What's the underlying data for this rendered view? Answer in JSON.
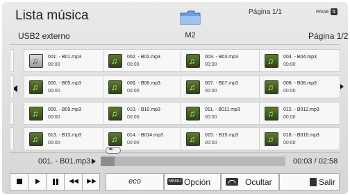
{
  "header": {
    "title": "Lista música",
    "source": "USB2 externo",
    "folder_label": "M2",
    "page_top": "Página 1/1",
    "page_button_label": "PAGE",
    "page_button_key": "⇅",
    "page_right": "Página 1/2"
  },
  "icons": {
    "folder": "folder-icon",
    "music": "music-note-icon",
    "prev_page": "left-arrow-icon",
    "next_page": "right-arrow-icon"
  },
  "tracks": [
    {
      "name": "001. - B01.mp3",
      "time": "00:00",
      "selected": true
    },
    {
      "name": "002. - B02.mp3",
      "time": "00:00"
    },
    {
      "name": "003. - B03.mp3",
      "time": "00:00"
    },
    {
      "name": "004. - B04.mp3",
      "time": "00:00"
    },
    {
      "name": "005. - B05.mp3",
      "time": "00:00"
    },
    {
      "name": "006. - B06.mp3",
      "time": "00:00"
    },
    {
      "name": "007. - B07.mp3",
      "time": "00:00"
    },
    {
      "name": "008. - B08.mp3",
      "time": "00:00"
    },
    {
      "name": "009. - B09.mp3",
      "time": "00:00"
    },
    {
      "name": "010. - B10.mp3",
      "time": "00:00"
    },
    {
      "name": "011. - B011.mp3",
      "time": "00:00"
    },
    {
      "name": "012. - B012.mp3",
      "time": "00:00"
    },
    {
      "name": "013. - B13.mp3",
      "time": "00:00"
    },
    {
      "name": "014. - B014.mp3",
      "time": "00:00"
    },
    {
      "name": "015. - B15.mp3",
      "time": "00:00"
    },
    {
      "name": "016. - B016.mp3",
      "time": "00:00"
    }
  ],
  "player": {
    "now_playing": "001. - B01.mp3",
    "elapsed_time": "00:03",
    "total_time": "02:58",
    "time_display": "00:03 / 02:58",
    "progress_fraction": 0.02
  },
  "controls": {
    "stop": "stop-icon",
    "play": "play-icon",
    "pause": "pause-icon",
    "rewind": "rewind-icon",
    "fast_forward": "fast-forward-icon"
  },
  "footer": {
    "eco_label": "eco",
    "menu_key": "MENU",
    "option_label": "Opción",
    "hide_label": "Ocultar",
    "exit_label": "Salir"
  }
}
